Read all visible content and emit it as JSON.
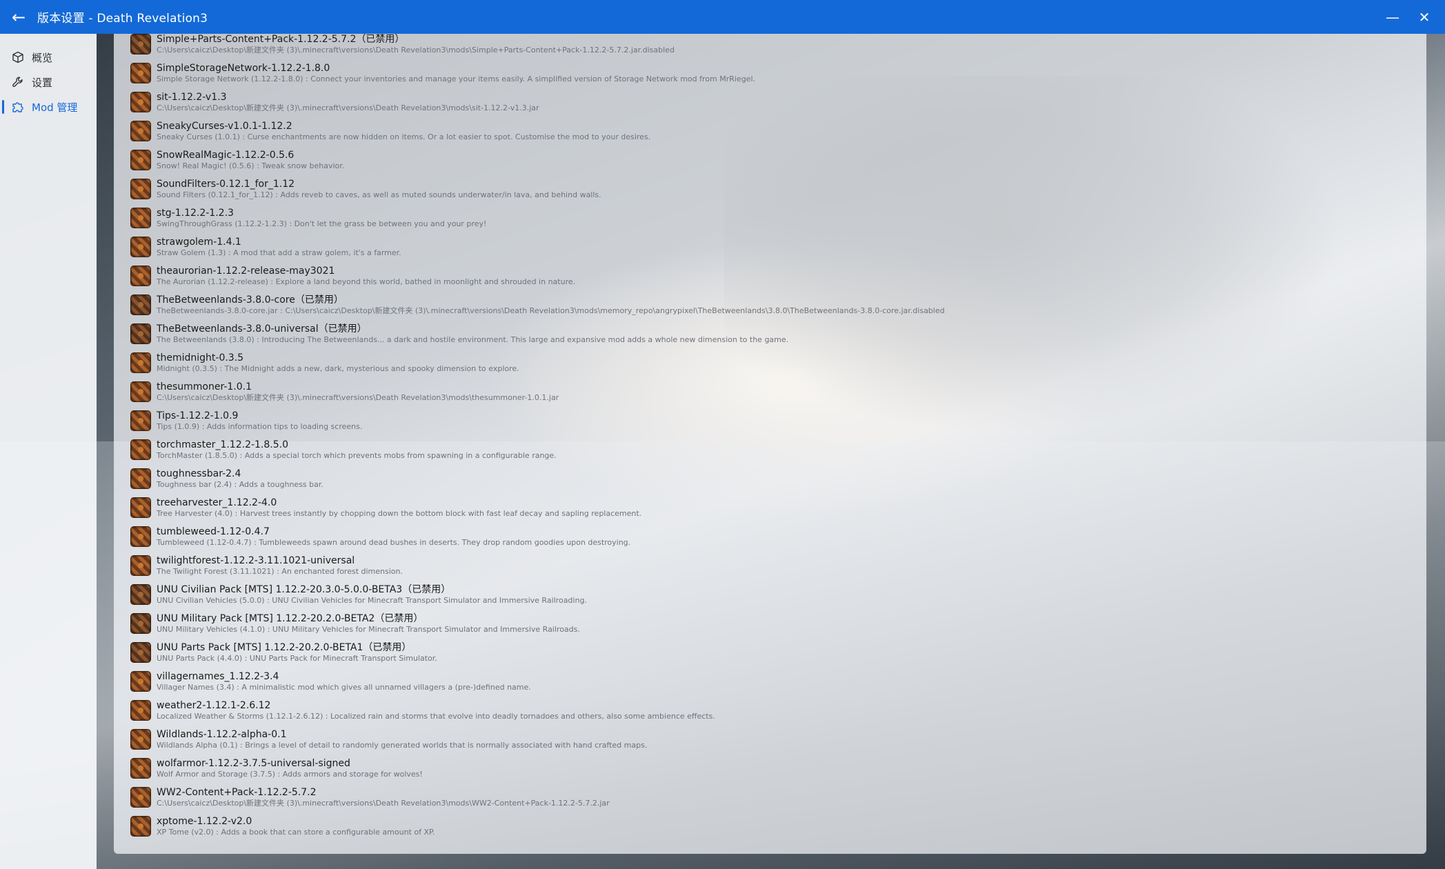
{
  "window": {
    "title": "版本设置 - Death Revelation3",
    "back_glyph": "←",
    "minimize_glyph": "—",
    "close_glyph": "✕"
  },
  "sidebar": {
    "items": [
      {
        "label": "概览",
        "icon": "cube-icon",
        "active": false
      },
      {
        "label": "设置",
        "icon": "wrench-icon",
        "active": false
      },
      {
        "label": "Mod 管理",
        "icon": "puzzle-icon",
        "active": true
      }
    ]
  },
  "mods": [
    {
      "name": "Simple+Parts-Content+Pack-1.12.2-5.7.2（已禁用）",
      "desc": "C:\\Users\\caicz\\Desktop\\新建文件夹 (3)\\.minecraft\\versions\\Death Revelation3\\mods\\Simple+Parts-Content+Pack-1.12.2-5.7.2.jar.disabled",
      "disabled": true
    },
    {
      "name": "SimpleStorageNetwork-1.12.2-1.8.0",
      "desc": "Simple Storage Network (1.12.2-1.8.0) : Connect your inventories and manage your items easily.  A simplified version of Storage Network mod from MrRiegel.",
      "disabled": false
    },
    {
      "name": "sit-1.12.2-v1.3",
      "desc": "C:\\Users\\caicz\\Desktop\\新建文件夹 (3)\\.minecraft\\versions\\Death Revelation3\\mods\\sit-1.12.2-v1.3.jar",
      "disabled": false
    },
    {
      "name": "SneakyCurses-v1.0.1-1.12.2",
      "desc": "Sneaky Curses (1.0.1) : Curse enchantments are now hidden on items. Or a lot easier to spot. Customise the mod to your desires.",
      "disabled": false
    },
    {
      "name": "SnowRealMagic-1.12.2-0.5.6",
      "desc": "Snow! Real Magic! (0.5.6) : Tweak snow behavior.",
      "disabled": false
    },
    {
      "name": "SoundFilters-0.12.1_for_1.12",
      "desc": "Sound Filters (0.12.1_for_1.12) : Adds reveb to caves, as well as muted sounds underwater/in lava, and behind walls.",
      "disabled": false
    },
    {
      "name": "stg-1.12.2-1.2.3",
      "desc": "SwingThroughGrass (1.12.2-1.2.3) : Don't let the grass be between you and your prey!",
      "disabled": false
    },
    {
      "name": "strawgolem-1.4.1",
      "desc": "Straw Golem (1.3) : A mod that add a straw golem, it's a farmer.",
      "disabled": false
    },
    {
      "name": "theaurorian-1.12.2-release-may3021",
      "desc": "The Aurorian (1.12.2-release) : Explore a land beyond this world, bathed in moonlight and shrouded in nature.",
      "disabled": false
    },
    {
      "name": "TheBetweenlands-3.8.0-core（已禁用）",
      "desc": "TheBetweenlands-3.8.0-core.jar : C:\\Users\\caicz\\Desktop\\新建文件夹 (3)\\.minecraft\\versions\\Death Revelation3\\mods\\memory_repo\\angrypixel\\TheBetweenlands\\3.8.0\\TheBetweenlands-3.8.0-core.jar.disabled",
      "disabled": true
    },
    {
      "name": "TheBetweenlands-3.8.0-universal（已禁用）",
      "desc": "The Betweenlands (3.8.0) : Introducing The Betweenlands... a dark and hostile environment. This large and expansive mod adds a whole new dimension to the game.",
      "disabled": true
    },
    {
      "name": "themidnight-0.3.5",
      "desc": "Midnight (0.3.5) : The Midnight adds a new, dark, mysterious and spooky dimension to explore.",
      "disabled": false
    },
    {
      "name": "thesummoner-1.0.1",
      "desc": "C:\\Users\\caicz\\Desktop\\新建文件夹 (3)\\.minecraft\\versions\\Death Revelation3\\mods\\thesummoner-1.0.1.jar",
      "disabled": false
    },
    {
      "name": "Tips-1.12.2-1.0.9",
      "desc": "Tips (1.0.9) : Adds information tips to loading screens.",
      "disabled": false
    },
    {
      "name": "torchmaster_1.12.2-1.8.5.0",
      "desc": "TorchMaster (1.8.5.0) : Adds a special torch which prevents mobs from spawning in a configurable range.",
      "disabled": false
    },
    {
      "name": "toughnessbar-2.4",
      "desc": "Toughness bar (2.4) : Adds a toughness bar.",
      "disabled": false
    },
    {
      "name": "treeharvester_1.12.2-4.0",
      "desc": "Tree Harvester (4.0) : Harvest trees instantly by chopping down the bottom block with fast leaf decay and sapling replacement.",
      "disabled": false
    },
    {
      "name": "tumbleweed-1.12-0.4.7",
      "desc": "Tumbleweed (1.12-0.4.7) : Tumbleweeds spawn around dead bushes in deserts. They drop random goodies upon destroying.",
      "disabled": false
    },
    {
      "name": "twilightforest-1.12.2-3.11.1021-universal",
      "desc": "The Twilight Forest (3.11.1021) : An enchanted forest dimension.",
      "disabled": false
    },
    {
      "name": "UNU Civilian Pack [MTS] 1.12.2-20.3.0-5.0.0-BETA3（已禁用）",
      "desc": "UNU Civilian Vehicles (5.0.0) : UNU Civilian Vehicles for Minecraft Transport Simulator and Immersive Railroading.",
      "disabled": true
    },
    {
      "name": "UNU Military Pack [MTS] 1.12.2-20.2.0-BETA2（已禁用）",
      "desc": "UNU Military Vehicles (4.1.0) : UNU Military Vehicles for Minecraft Transport Simulator and Immersive Railroads.",
      "disabled": true
    },
    {
      "name": "UNU Parts Pack [MTS] 1.12.2-20.2.0-BETA1（已禁用）",
      "desc": "UNU Parts Pack (4.4.0) : UNU Parts Pack for Minecraft Transport Simulator.",
      "disabled": true
    },
    {
      "name": "villagernames_1.12.2-3.4",
      "desc": "Villager Names (3.4) : A minimalistic mod which gives all unnamed villagers a (pre-)defined name.",
      "disabled": false
    },
    {
      "name": "weather2-1.12.1-2.6.12",
      "desc": "Localized Weather & Storms (1.12.1-2.6.12) : Localized rain and storms that evolve into deadly tornadoes and others, also some ambience effects.",
      "disabled": false
    },
    {
      "name": "Wildlands-1.12.2-alpha-0.1",
      "desc": "Wildlands Alpha (0.1) : Brings a level of detail to randomly generated worlds that is normally associated with hand crafted maps.",
      "disabled": false
    },
    {
      "name": "wolfarmor-1.12.2-3.7.5-universal-signed",
      "desc": "Wolf Armor and Storage (3.7.5) : Adds armors and storage for wolves!",
      "disabled": false
    },
    {
      "name": "WW2-Content+Pack-1.12.2-5.7.2",
      "desc": "C:\\Users\\caicz\\Desktop\\新建文件夹 (3)\\.minecraft\\versions\\Death Revelation3\\mods\\WW2-Content+Pack-1.12.2-5.7.2.jar",
      "disabled": false
    },
    {
      "name": "xptome-1.12.2-v2.0",
      "desc": "XP Tome (v2.0) : Adds a book that can store a configurable amount of XP.",
      "disabled": false
    }
  ],
  "colors": {
    "accent": "#1469d8",
    "title_bar": "#1469d8",
    "mod_name": "#1a1a1a",
    "mod_desc": "#6e737a"
  }
}
